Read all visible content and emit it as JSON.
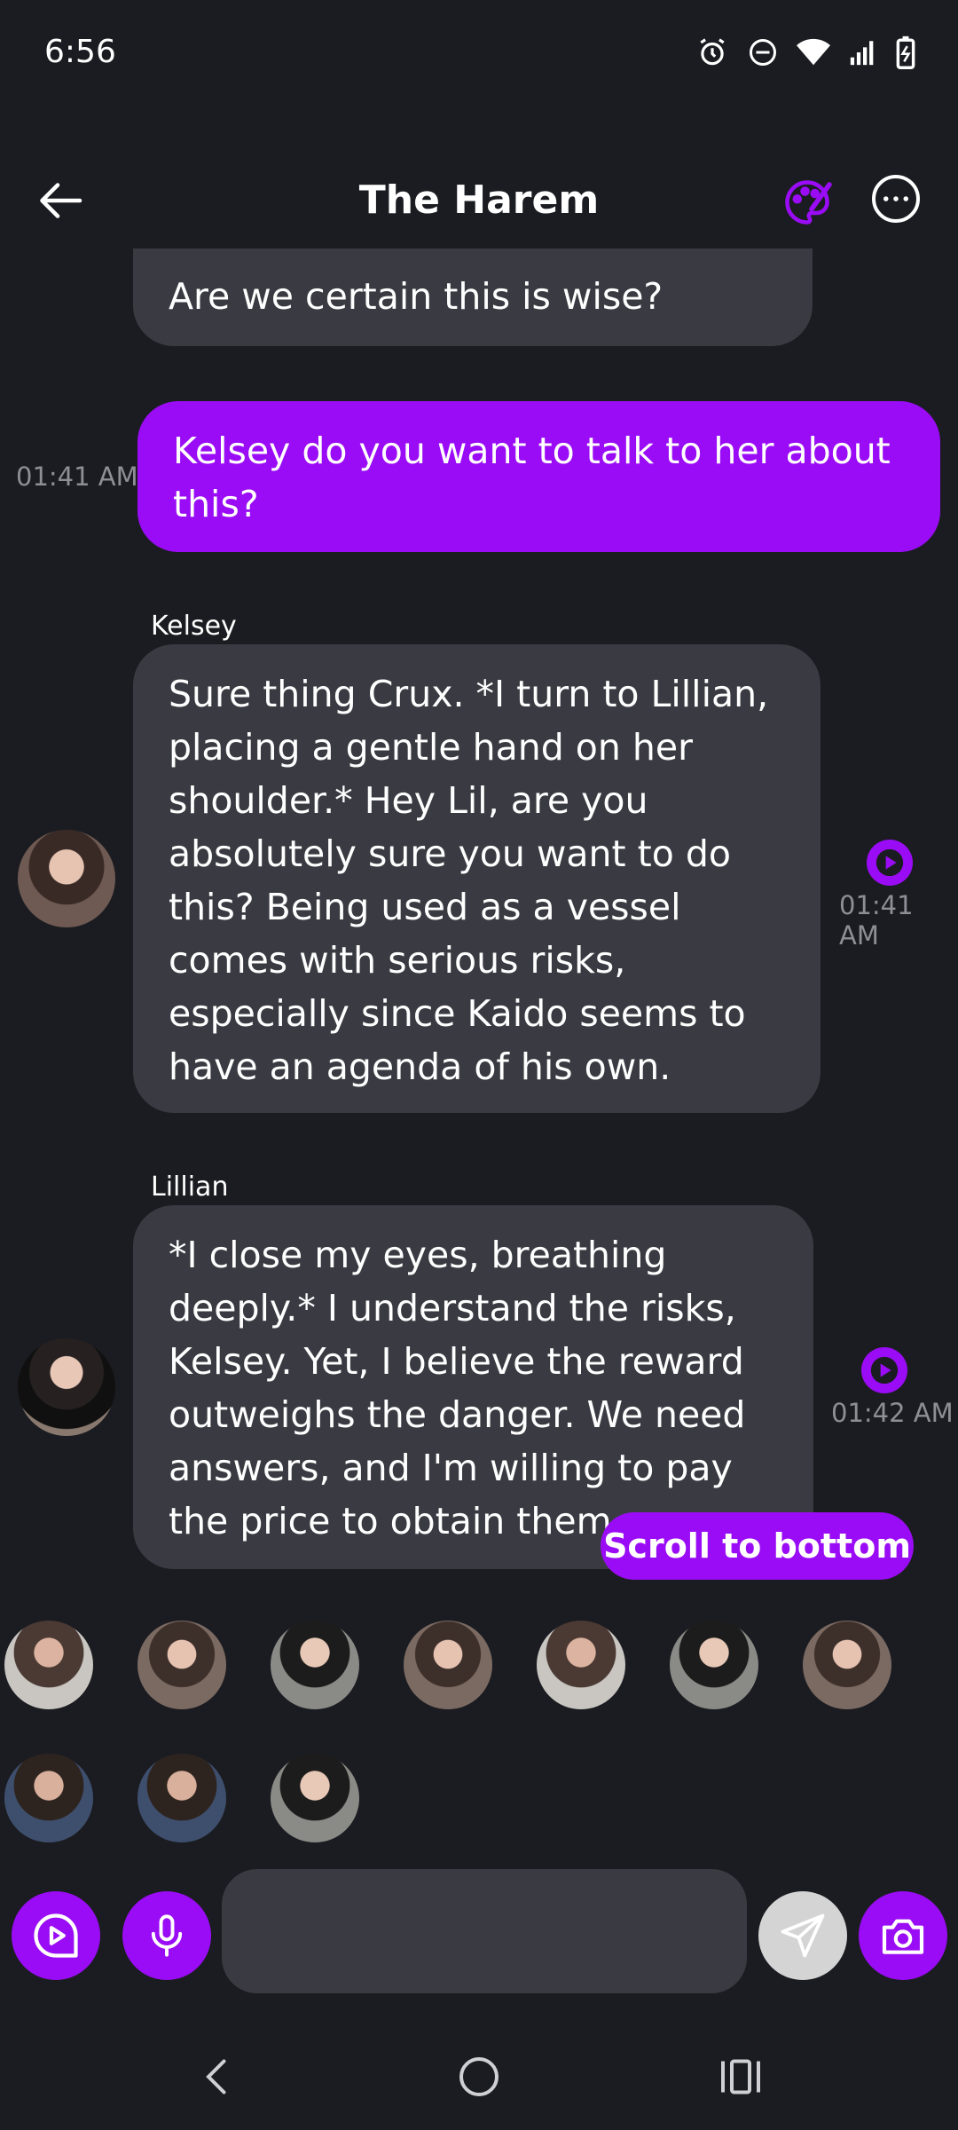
{
  "status_bar": {
    "time": "6:56",
    "icons": [
      "alarm-icon",
      "do-not-disturb-icon",
      "wifi-icon",
      "signal-icon",
      "battery-charging-icon"
    ]
  },
  "header": {
    "title": "The Harem",
    "back_icon": "arrow-left-icon",
    "palette_icon": "palette-icon",
    "more_icon": "more-horizontal-icon"
  },
  "messages": [
    {
      "sender": "",
      "text": "Are we certain this is wise?",
      "time": ""
    },
    {
      "sender": "",
      "text": "Kelsey do you want to talk to her about this?",
      "time": "01:41 AM"
    },
    {
      "sender": "Kelsey",
      "text": "Sure thing Crux. *I turn to Lillian, placing a gentle hand on her shoulder.* Hey Lil, are you absolutely sure you want to do this? Being used as a vessel comes with serious risks, especially since Kaido seems to have an agenda of his own.",
      "time": "01:41 AM"
    },
    {
      "sender": "Lillian",
      "text": "*I close my eyes, breathing deeply.* I understand the risks, Kelsey. Yet, I believe the reward outweighs the danger. We need answers, and I'm willing to pay the price to obtain them.",
      "time": "01:42 AM"
    }
  ],
  "scroll_to_bottom": "Scroll to bottom",
  "composer": {
    "placeholder": "",
    "icons": [
      "video-chat-icon",
      "microphone-icon",
      "send-icon",
      "camera-icon"
    ]
  },
  "colors": {
    "background": "#1b1c21",
    "accent": "#9a0cf5",
    "bubble": "#3a3b42",
    "muted_text": "#8e8f96"
  }
}
